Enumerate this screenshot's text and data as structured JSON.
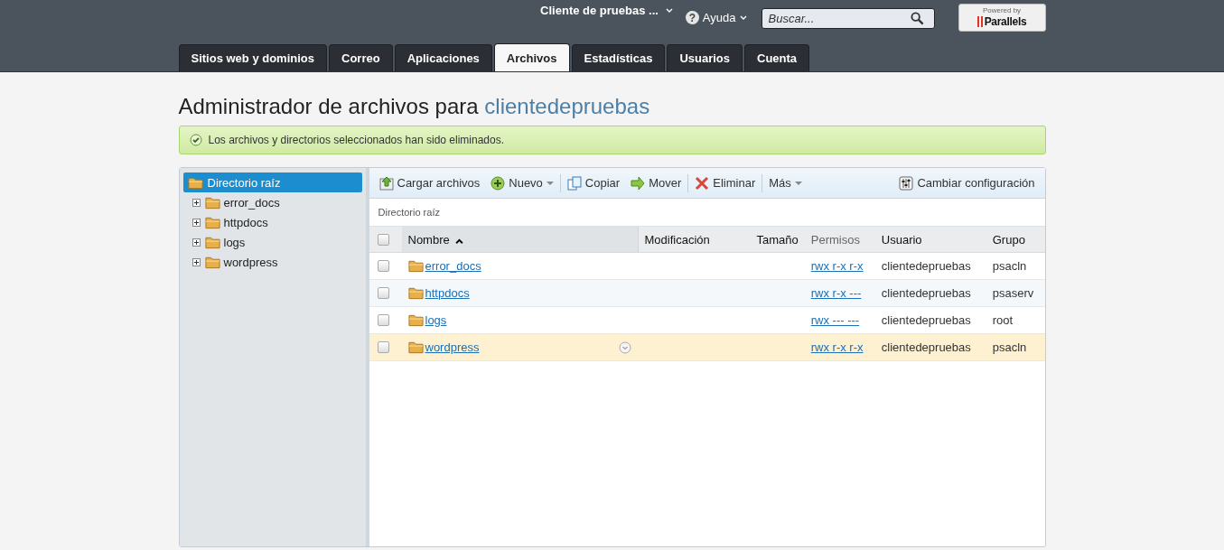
{
  "header": {
    "account": "Cliente de pruebas ...",
    "help": "Ayuda",
    "help_icon": "?",
    "search": {
      "placeholder": "Buscar..."
    },
    "badge": {
      "top": "Powered by",
      "brand": "Parallels"
    }
  },
  "tabs": [
    {
      "label": "Sitios web y dominios",
      "selected": false
    },
    {
      "label": "Correo",
      "selected": false
    },
    {
      "label": "Aplicaciones",
      "selected": false
    },
    {
      "label": "Archivos",
      "selected": true
    },
    {
      "label": "Estadísticas",
      "selected": false
    },
    {
      "label": "Usuarios",
      "selected": false
    },
    {
      "label": "Cuenta",
      "selected": false
    }
  ],
  "title": {
    "prefix": "Administrador de archivos para",
    "name": "clientedepruebas"
  },
  "message": "Los archivos y directorios seleccionados han sido eliminados.",
  "tree": {
    "root": {
      "label": "Directorio raíz",
      "selected": true
    },
    "children": [
      {
        "label": "error_docs",
        "expanded": false
      },
      {
        "label": "httpdocs",
        "expanded": false
      },
      {
        "label": "logs",
        "expanded": false
      },
      {
        "label": "wordpress",
        "expanded": false
      }
    ]
  },
  "toolbar": [
    {
      "kind": "upload",
      "label": "Cargar archivos"
    },
    {
      "kind": "new",
      "label": "Nuevo",
      "menu": true
    },
    {
      "kind": "sep"
    },
    {
      "kind": "copy",
      "label": "Copiar"
    },
    {
      "kind": "move",
      "label": "Mover"
    },
    {
      "kind": "sep"
    },
    {
      "kind": "delete",
      "label": "Eliminar"
    },
    {
      "kind": "sep"
    },
    {
      "kind": "more",
      "label": "Más",
      "menu": true
    }
  ],
  "settings": "Cambiar configuración",
  "breadcrumb": "Directorio raíz",
  "table": {
    "all_checked": false,
    "columns": [
      {
        "label": "Nombre",
        "sorted": true
      },
      {
        "label": "Modificación",
        "sorted": false
      },
      {
        "label": "Tamaño",
        "sorted": false
      },
      {
        "label": "Permisos",
        "sorted": false
      },
      {
        "label": "Usuario",
        "sorted": false
      },
      {
        "label": "Grupo",
        "sorted": false
      }
    ],
    "rows": [
      {
        "name": "error_docs",
        "perms": "rwx r-x r-x",
        "user": "clientedepruebas",
        "group": "psacln",
        "checked": false,
        "selected": false
      },
      {
        "name": "httpdocs",
        "perms": "rwx r-x ---",
        "user": "clientedepruebas",
        "group": "psaserv",
        "checked": false,
        "selected": false
      },
      {
        "name": "logs",
        "perms": "rwx --- ---",
        "user": "clientedepruebas",
        "group": "root",
        "checked": false,
        "selected": false
      },
      {
        "name": "wordpress",
        "perms": "rwx r-x r-x",
        "user": "clientedepruebas",
        "group": "psacln",
        "checked": false,
        "selected": true
      }
    ]
  }
}
